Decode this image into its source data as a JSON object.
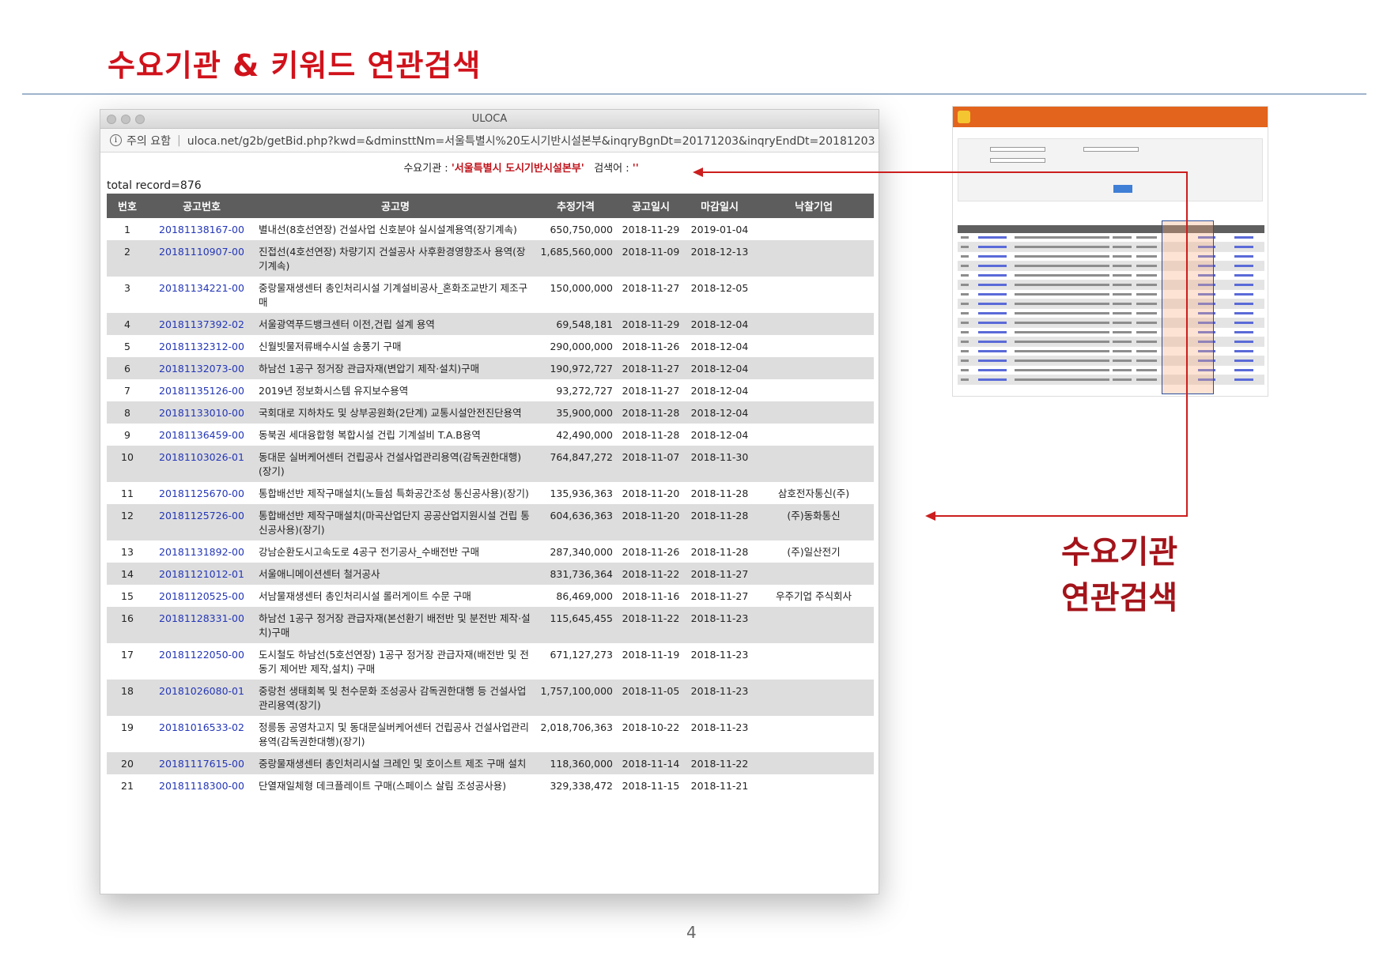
{
  "slide": {
    "title": "수요기관 & 키워드 연관검색",
    "callout_line1": "수요기관",
    "callout_line2": "연관검색",
    "page_number": "4"
  },
  "browser": {
    "window_title": "ULOCA",
    "security_label": "주의 요함",
    "url": "uloca.net/g2b/getBid.php?kwd=&dminsttNm=서울특별시%20도시기반시설본부&inqryBgnDt=20171203&inqryEndDt=20181203"
  },
  "search": {
    "agency_label": "수요기관 : ",
    "agency_value": "'서울특별시 도시기반시설본부'",
    "keyword_label": "검색어 : ",
    "keyword_value": "''",
    "total_record": "total record=876"
  },
  "table": {
    "headers": [
      "번호",
      "공고번호",
      "공고명",
      "추정가격",
      "공고일시",
      "마감일시",
      "낙찰기업"
    ],
    "rows": [
      {
        "no": "1",
        "bid": "20181138167-00",
        "name": "별내선(8호선연장) 건설사업 신호분야 실시설계용역(장기계속)",
        "price": "650,750,000",
        "posted": "2018-11-29",
        "closing": "2019-01-04",
        "winner": ""
      },
      {
        "no": "2",
        "bid": "20181110907-00",
        "name": "진접선(4호선연장) 차량기지 건설공사 사후환경영향조사 용역(장기계속)",
        "price": "1,685,560,000",
        "posted": "2018-11-09",
        "closing": "2018-12-13",
        "winner": ""
      },
      {
        "no": "3",
        "bid": "20181134221-00",
        "name": "중랑물재생센터 총인처리시설 기계설비공사_혼화조교반기 제조구매",
        "price": "150,000,000",
        "posted": "2018-11-27",
        "closing": "2018-12-05",
        "winner": ""
      },
      {
        "no": "4",
        "bid": "20181137392-02",
        "name": "서울광역푸드뱅크센터 이전,건립 설계 용역",
        "price": "69,548,181",
        "posted": "2018-11-29",
        "closing": "2018-12-04",
        "winner": ""
      },
      {
        "no": "5",
        "bid": "20181132312-00",
        "name": "신월빗물저류배수시설 송풍기 구매",
        "price": "290,000,000",
        "posted": "2018-11-26",
        "closing": "2018-12-04",
        "winner": ""
      },
      {
        "no": "6",
        "bid": "20181132073-00",
        "name": "하남선 1공구 정거장 관급자재(변압기 제작·설치)구매",
        "price": "190,972,727",
        "posted": "2018-11-27",
        "closing": "2018-12-04",
        "winner": ""
      },
      {
        "no": "7",
        "bid": "20181135126-00",
        "name": "2019년 정보화시스템 유지보수용역",
        "price": "93,272,727",
        "posted": "2018-11-27",
        "closing": "2018-12-04",
        "winner": ""
      },
      {
        "no": "8",
        "bid": "20181133010-00",
        "name": "국회대로 지하차도 및 상부공원화(2단계) 교통시설안전진단용역",
        "price": "35,900,000",
        "posted": "2018-11-28",
        "closing": "2018-12-04",
        "winner": ""
      },
      {
        "no": "9",
        "bid": "20181136459-00",
        "name": "동북권 세대융합형 복합시설 건립 기계설비 T.A.B용역",
        "price": "42,490,000",
        "posted": "2018-11-28",
        "closing": "2018-12-04",
        "winner": ""
      },
      {
        "no": "10",
        "bid": "20181103026-01",
        "name": "동대문 실버케어센터 건립공사 건설사업관리용역(감독권한대행)(장기)",
        "price": "764,847,272",
        "posted": "2018-11-07",
        "closing": "2018-11-30",
        "winner": ""
      },
      {
        "no": "11",
        "bid": "20181125670-00",
        "name": "통합배선반 제작구매설치(노들섬 특화공간조성 통신공사용)(장기)",
        "price": "135,936,363",
        "posted": "2018-11-20",
        "closing": "2018-11-28",
        "winner": "삼호전자통신(주)"
      },
      {
        "no": "12",
        "bid": "20181125726-00",
        "name": "통합배선반 제작구매설치(마곡산업단지 공공산업지원시설 건립 통신공사용)(장기)",
        "price": "604,636,363",
        "posted": "2018-11-20",
        "closing": "2018-11-28",
        "winner": "(주)동화통신"
      },
      {
        "no": "13",
        "bid": "20181131892-00",
        "name": "강남순환도시고속도로 4공구 전기공사_수배전반 구매",
        "price": "287,340,000",
        "posted": "2018-11-26",
        "closing": "2018-11-28",
        "winner": "(주)일산전기"
      },
      {
        "no": "14",
        "bid": "20181121012-01",
        "name": "서울애니메이션센터 철거공사",
        "price": "831,736,364",
        "posted": "2018-11-22",
        "closing": "2018-11-27",
        "winner": ""
      },
      {
        "no": "15",
        "bid": "20181120525-00",
        "name": "서남물재생센터 총인처리시설 롤러게이트 수문 구매",
        "price": "86,469,000",
        "posted": "2018-11-16",
        "closing": "2018-11-27",
        "winner": "우주기업 주식회사"
      },
      {
        "no": "16",
        "bid": "20181128331-00",
        "name": "하남선 1공구 정거장 관급자재(본선환기 배전반 및 분전반 제작·설치)구매",
        "price": "115,645,455",
        "posted": "2018-11-22",
        "closing": "2018-11-23",
        "winner": ""
      },
      {
        "no": "17",
        "bid": "20181122050-00",
        "name": "도시철도 하남선(5호선연장) 1공구 정거장 관급자재(배전반 및 전동기 제어반 제작,설치) 구매",
        "price": "671,127,273",
        "posted": "2018-11-19",
        "closing": "2018-11-23",
        "winner": ""
      },
      {
        "no": "18",
        "bid": "20181026080-01",
        "name": "중랑천 생태회복 및 천수문화 조성공사 감독권한대행 등 건설사업관리용역(장기)",
        "price": "1,757,100,000",
        "posted": "2018-11-05",
        "closing": "2018-11-23",
        "winner": ""
      },
      {
        "no": "19",
        "bid": "20181016533-02",
        "name": "정릉동 공영차고지 및 동대문실버케어센터 건립공사 건설사업관리용역(감독권한대행)(장기)",
        "price": "2,018,706,363",
        "posted": "2018-10-22",
        "closing": "2018-11-23",
        "winner": ""
      },
      {
        "no": "20",
        "bid": "20181117615-00",
        "name": "중랑물재생센터 총인처리시설 크레인 및 호이스트 제조 구매 설치",
        "price": "118,360,000",
        "posted": "2018-11-14",
        "closing": "2018-11-22",
        "winner": ""
      },
      {
        "no": "21",
        "bid": "20181118300-00",
        "name": "단열재일체형 데크플레이트 구매(스페이스 살림 조성공사용)",
        "price": "329,338,472",
        "posted": "2018-11-15",
        "closing": "2018-11-21",
        "winner": ""
      }
    ]
  },
  "colors": {
    "title_red": "#d0121b",
    "callout_red": "#a3141a",
    "arrow_red": "#cc1e1e",
    "link_blue": "#2336b8",
    "header_gray": "#5d5d5d",
    "thumb_orange": "#e3641c"
  },
  "icons": {
    "info": "info-circle-icon",
    "arrow": "arrow-left-icon"
  }
}
